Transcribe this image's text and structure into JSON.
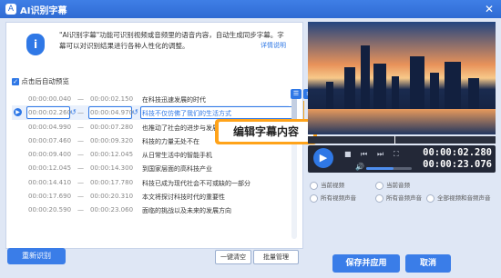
{
  "window": {
    "title": "AI识别字幕",
    "close_label": "✕",
    "app_icon_label": "A"
  },
  "notice": {
    "text": "\"AI识别字幕\"功能可识别视频或音频里的语音内容，自动生成同步字幕。字幕可以对识别结果进行各种人性化的调整。",
    "link": "详情说明"
  },
  "autoplay": {
    "label": "点击后自动预览",
    "checked": true
  },
  "rows": [
    {
      "start": "00:00:00.040",
      "end": "00:00:02.150",
      "text": "在科技迅速发展的时代"
    },
    {
      "start": "00:00:02.260",
      "end": "00:00:04.970",
      "text": "科技不仅仿佛了我们的生活方式"
    },
    {
      "start": "00:00:04.990",
      "end": "00:00:07.280",
      "text": "也推动了社会的进步与发展"
    },
    {
      "start": "00:00:07.460",
      "end": "00:00:09.320",
      "text": "科技的力量无处不在"
    },
    {
      "start": "00:00:09.400",
      "end": "00:00:12.045",
      "text": "从日常生活中的智能手机"
    },
    {
      "start": "00:00:12.045",
      "end": "00:00:14.300",
      "text": "到国家层面的高科技产业"
    },
    {
      "start": "00:00:14.410",
      "end": "00:00:17.780",
      "text": "科技已成为现代社会不可或缺的一部分"
    },
    {
      "start": "00:00:17.690",
      "end": "00:00:20.310",
      "text": "本文将探讨科技时代的重要性"
    },
    {
      "start": "00:00:20.590",
      "end": "00:00:23.060",
      "text": "面临的挑战以及未来的发展方向"
    }
  ],
  "callout": "编辑字幕内容",
  "buttons": {
    "re_recognize": "重新识别",
    "clear": "一键清空",
    "batch": "批量管理",
    "save": "保存并应用",
    "cancel": "取消"
  },
  "player": {
    "current_time": "00:00:02.280",
    "total_time": "00:00:23.076",
    "volume_level": 0.6
  },
  "audio_options": [
    "当前视频",
    "当前音频",
    "所有视频声音",
    "所有音频声音",
    "全部视频和音频声音"
  ]
}
